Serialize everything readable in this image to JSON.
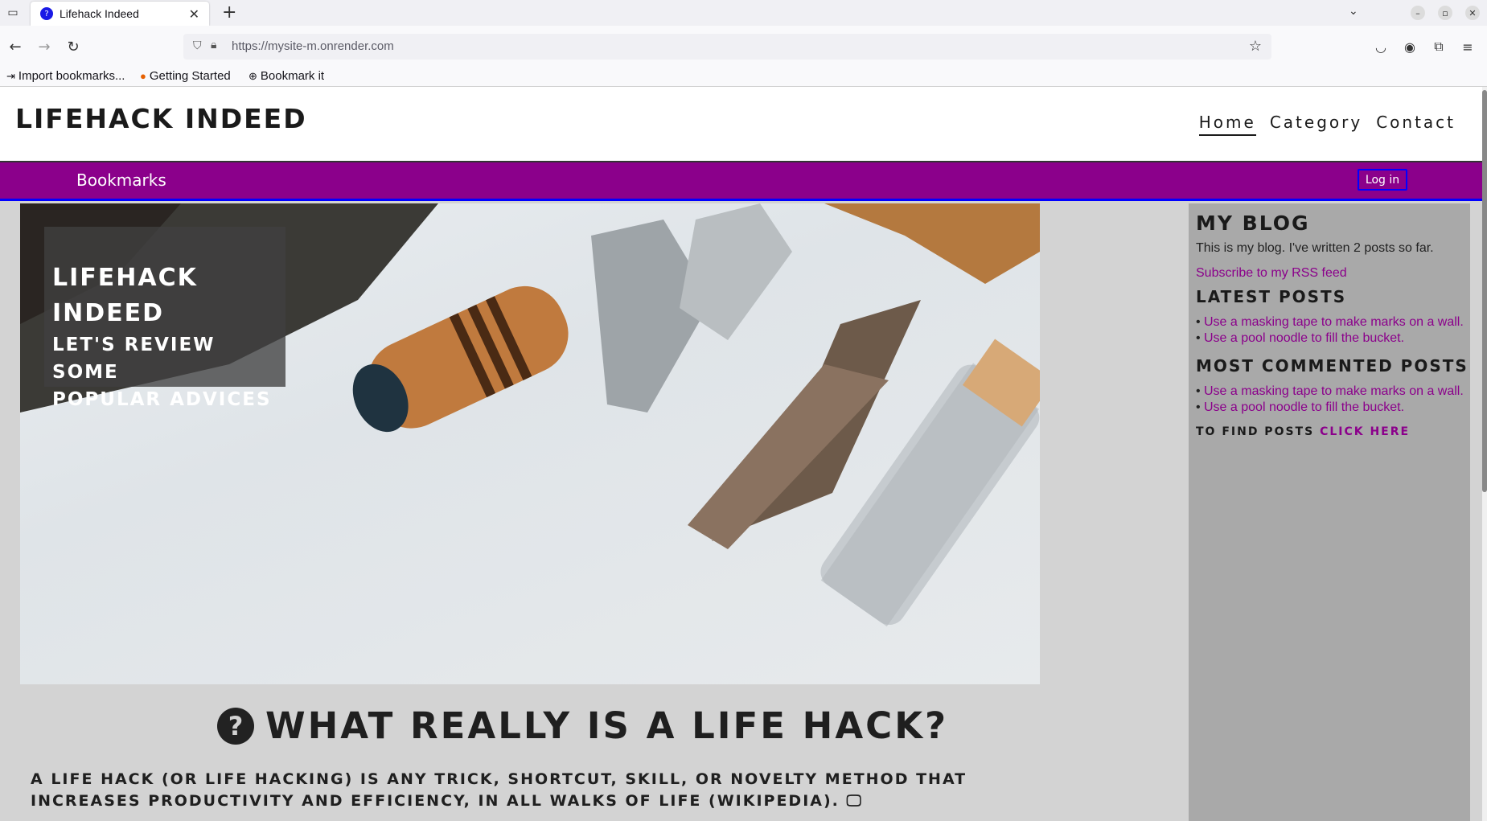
{
  "browser": {
    "tab_title": "Lifehack Indeed",
    "url": "https://mysite-m.onrender.com",
    "bookmarks": [
      {
        "label": "Import bookmarks...",
        "icon": "import-icon"
      },
      {
        "label": "Getting Started",
        "icon": "firefox-icon"
      },
      {
        "label": "Bookmark it",
        "icon": "globe-icon"
      }
    ]
  },
  "site": {
    "title": "LIFEHACK INDEED",
    "nav": [
      "Home",
      "Category",
      "Contact"
    ],
    "bar": {
      "bookmarks": "Bookmarks",
      "login": "Log in"
    },
    "hero": {
      "title_line1": "LIFEHACK",
      "title_line2": "INDEED",
      "sub_line1": "LET'S REVIEW SOME",
      "sub_line2": "POPULAR ADVICES"
    },
    "sidebar": {
      "blog_title": "MY BLOG",
      "blog_text": "This is my blog. I've written 2 posts so far.",
      "rss": "Subscribe to my RSS feed",
      "latest_title": "LATEST POSTS",
      "latest": [
        "Use a masking tape to make marks on a wall.",
        "Use a pool noodle to fill the bucket."
      ],
      "commented_title": "MOST COMMENTED POSTS",
      "commented": [
        "Use a masking tape to make marks on a wall.",
        "Use a pool noodle to fill the bucket."
      ],
      "find_prefix": "TO FIND POSTS",
      "find_link": "CLICK HERE"
    },
    "content": {
      "heading": "WHAT REALLY IS A LIFE HACK?",
      "paragraph": "A LIFE HACK (OR LIFE HACKING) IS ANY TRICK, SHORTCUT, SKILL, OR NOVELTY METHOD THAT INCREASES PRODUCTIVITY AND EFFICIENCY, IN ALL WALKS OF LIFE (WIKIPEDIA)."
    }
  },
  "colors": {
    "accent": "#8b008b",
    "link": "#8b008b",
    "sidebar_bg": "#a9a9a9",
    "page_bg": "#d3d3d3"
  }
}
